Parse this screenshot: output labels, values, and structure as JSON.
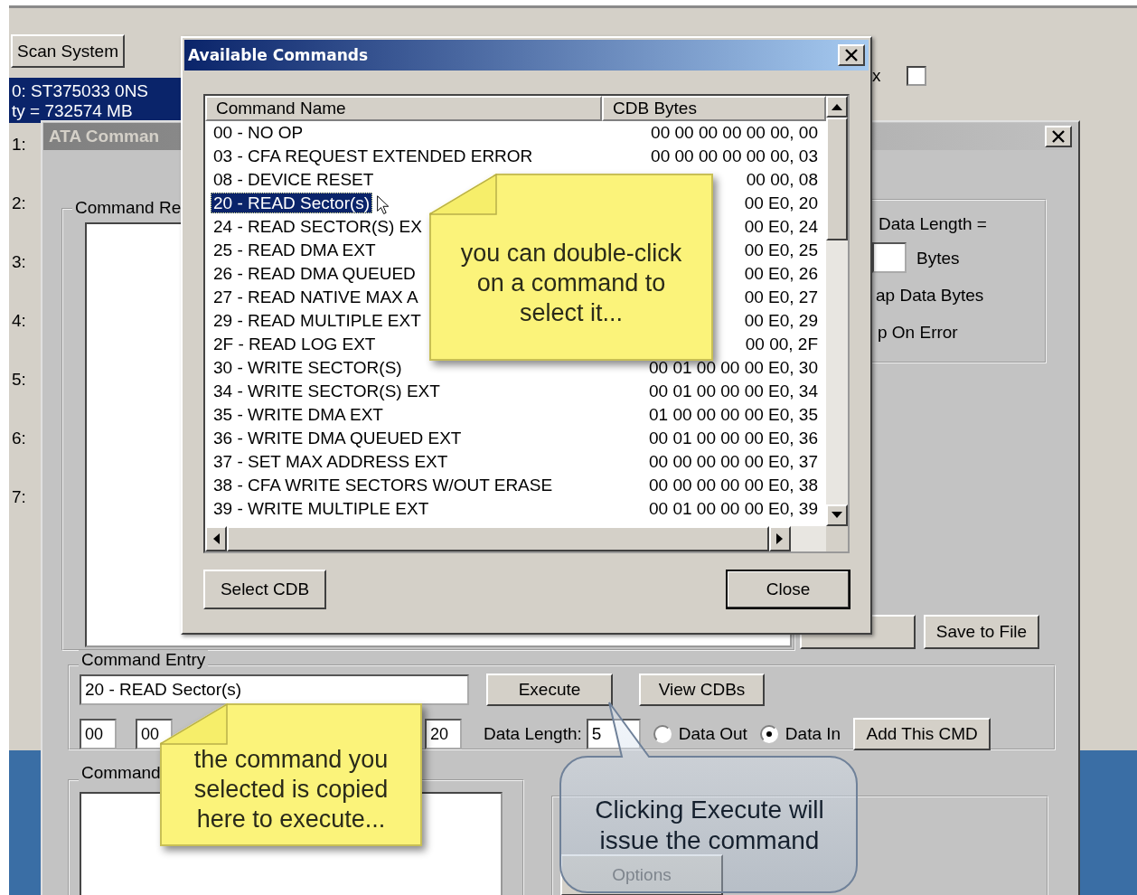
{
  "main_window": {
    "scan_button": "Scan System",
    "devices": [
      {
        "lines": [
          "0: ST375033 0NS",
          "ty = 732574 MB"
        ],
        "selected": true
      },
      {
        "lines": [
          "1:"
        ],
        "selected": false
      },
      {
        "lines": [
          "2:"
        ],
        "selected": false
      },
      {
        "lines": [
          "3:"
        ],
        "selected": false
      },
      {
        "lines": [
          "4:"
        ],
        "selected": false
      },
      {
        "lines": [
          "5:"
        ],
        "selected": false
      },
      {
        "lines": [
          "6:"
        ],
        "selected": false
      },
      {
        "lines": [
          "7:"
        ],
        "selected": false
      }
    ],
    "option": {
      "label": "x",
      "checked": false
    }
  },
  "ata_window": {
    "title": "ATA Comman",
    "results_group": "Command Re",
    "settings": {
      "data_length_label": "Data Length =",
      "bytes_label": "Bytes",
      "swap_label": "ap Data Bytes",
      "stop_label": "p On Error"
    },
    "save_button": "Save to File",
    "entry": {
      "title": "Command Entry",
      "command_value": "20 - READ Sector(s)",
      "execute_button": "Execute",
      "view_button": "View CDBs",
      "byte_fields": [
        "00",
        "00",
        "20"
      ],
      "data_length_label": "Data Length:",
      "data_length_value": "5",
      "directions": [
        {
          "label": "Data Out",
          "selected": false
        },
        {
          "label": "Data In",
          "selected": true
        }
      ],
      "add_button": "Add This CMD"
    },
    "commands_group": "Command",
    "options_button": {
      "label": "Options",
      "disabled": true
    }
  },
  "dialog": {
    "title": "Available Commands",
    "columns": [
      "Command Name",
      "CDB Bytes"
    ],
    "commands": [
      {
        "name": "00 - NO OP",
        "cdb": "00 00 00 00 00 00, 00",
        "selected": false
      },
      {
        "name": "03 - CFA REQUEST EXTENDED ERROR",
        "cdb": "00 00 00 00 00 00, 03",
        "selected": false
      },
      {
        "name": "08 - DEVICE RESET",
        "cdb": "00 00, 08",
        "selected": false
      },
      {
        "name": "20 - READ Sector(s)",
        "cdb": "00 E0, 20",
        "selected": true
      },
      {
        "name": "24 - READ SECTOR(S) EX",
        "cdb": "00 E0, 24",
        "selected": false
      },
      {
        "name": "25 - READ DMA EXT",
        "cdb": "00 E0, 25",
        "selected": false
      },
      {
        "name": "26 - READ DMA QUEUED",
        "cdb": "00 E0, 26",
        "selected": false
      },
      {
        "name": "27 - READ NATIVE MAX A",
        "cdb": "00 E0, 27",
        "selected": false
      },
      {
        "name": "29 - READ MULTIPLE EXT",
        "cdb": "00 E0, 29",
        "selected": false
      },
      {
        "name": "2F - READ LOG EXT",
        "cdb": "00 00, 2F",
        "selected": false
      },
      {
        "name": "30 - WRITE SECTOR(S)",
        "cdb": "00 01 00 00 00 E0, 30",
        "selected": false
      },
      {
        "name": "34 - WRITE SECTOR(S) EXT",
        "cdb": "00 01 00 00 00 E0, 34",
        "selected": false
      },
      {
        "name": "35 - WRITE DMA EXT",
        "cdb": "01 00 00 00 00 E0, 35",
        "selected": false
      },
      {
        "name": "36 - WRITE DMA QUEUED EXT",
        "cdb": "00 01 00 00 00 E0, 36",
        "selected": false
      },
      {
        "name": "37 - SET MAX ADDRESS EXT",
        "cdb": "00 00 00 00 00 E0, 37",
        "selected": false
      },
      {
        "name": "38 - CFA WRITE SECTORS W/OUT ERASE",
        "cdb": "00 00 00 00 00 E0, 38",
        "selected": false
      },
      {
        "name": "39 - WRITE MULTIPLE EXT",
        "cdb": "00 01 00 00 00 E0, 39",
        "selected": false
      }
    ],
    "select_button": "Select CDB",
    "close_button": "Close"
  },
  "callouts": [
    {
      "kind": "note",
      "text": "you can double-click\non a command to\nselect it..."
    },
    {
      "kind": "note",
      "text": "the command you\nselected is copied\nhere to execute..."
    },
    {
      "kind": "bubble",
      "text": "Clicking Execute will\nissue the command"
    }
  ]
}
